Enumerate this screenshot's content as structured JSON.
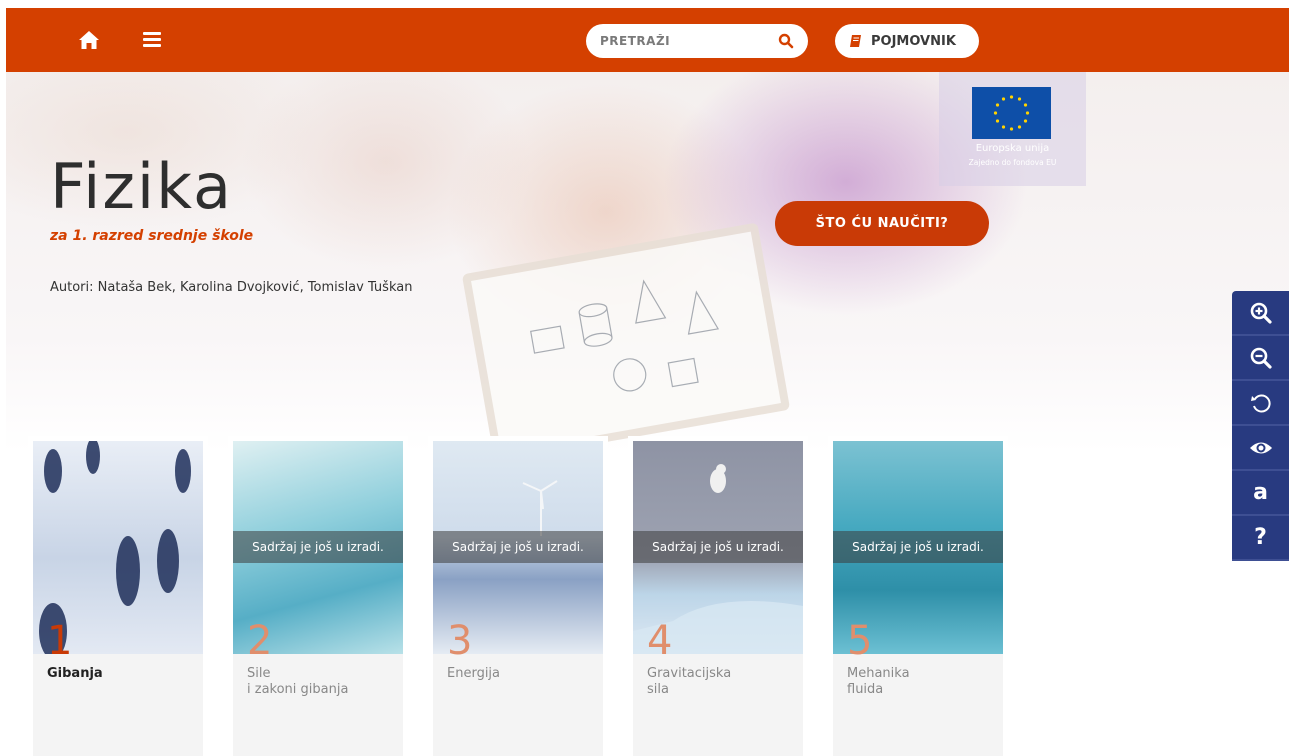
{
  "topbar": {
    "search_placeholder": "PRETRAŽI",
    "glossary_label": "POJMOVNIK"
  },
  "hero": {
    "title": "Fizika",
    "subtitle": "za 1. razred srednje škole",
    "authors": "Autori: Nataša Bek, Karolina Dvojković, Tomislav Tuškan",
    "learn_button": "ŠTO ĆU NAUČITI?",
    "eu_line1": "Europska unija",
    "eu_line2": "Zajedno do fondova EU"
  },
  "tools": [
    {
      "icon": "zoom-in-icon"
    },
    {
      "icon": "zoom-out-icon"
    },
    {
      "icon": "reset-icon"
    },
    {
      "icon": "eye-icon"
    },
    {
      "icon": "font-icon",
      "label": "a"
    },
    {
      "icon": "help-icon",
      "label": "?"
    }
  ],
  "chapters": [
    {
      "number": "1",
      "title_line1": "Gibanja",
      "title_line2": "",
      "overlay": ""
    },
    {
      "number": "2",
      "title_line1": "Sile",
      "title_line2": "i zakoni gibanja",
      "overlay": "Sadržaj je još u izradi."
    },
    {
      "number": "3",
      "title_line1": "Energija",
      "title_line2": "",
      "overlay": "Sadržaj je još u izradi."
    },
    {
      "number": "4",
      "title_line1": "Gravitacijska",
      "title_line2": "sila",
      "overlay": "Sadržaj je još u izradi."
    },
    {
      "number": "5",
      "title_line1": "Mehanika",
      "title_line2": "fluida",
      "overlay": "Sadržaj je još u izradi."
    }
  ],
  "colors": {
    "brand": "#d44000",
    "tool_rail": "#283a80",
    "eu_blue": "#0e4fa8"
  }
}
